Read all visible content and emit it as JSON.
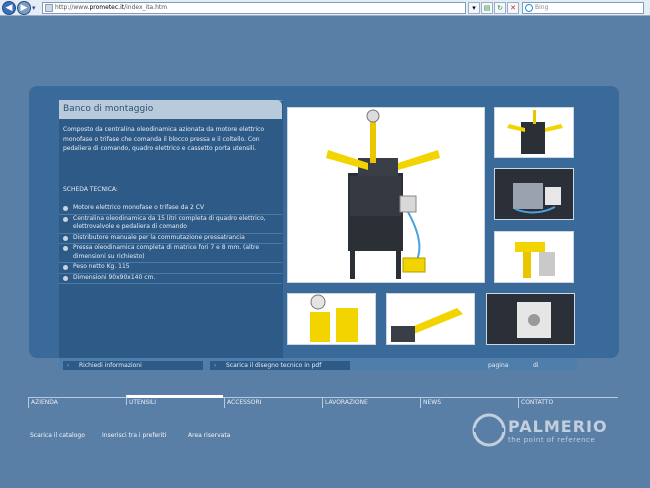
{
  "browser": {
    "url_prefix": "http://www.",
    "url_domain": "prometec.it",
    "url_path": "/index_ita.htm",
    "search_placeholder": "Bing"
  },
  "product": {
    "title": "Banco di montaggio",
    "description": "Composto da centralina oleodinamica azionata da motore elettrico monofase o trifase che comanda il blocco pressa e il coltello. Con pedaliera di comando, quadro elettrico e cassetto porta utensili.",
    "tech_heading": "SCHEDA TECNICA:",
    "specs": [
      "Motore elettrico monofase o trifase da 2 CV",
      "Centralina oleodinamica da 15 litri completa di quadro elettrico, elettrovalvole e pedaliera di comando",
      "Distributore manuale per la commutazione pressatrancia",
      "Pressa oleodinamica completa di matrice fori 7 e 8 mm. (altre dimensioni su richiesto)",
      "Peso netto Kg. 115",
      "Dimensioni 90x90x140 cm."
    ]
  },
  "actions": {
    "info_label": "Richiedi informazioni",
    "pdf_label": "Scarica il disegno tecnico in pdf",
    "page_label": "pagina",
    "of_label": "di"
  },
  "menu": {
    "items": [
      "AZIENDA",
      "UTENSILI",
      "ACCESSORI",
      "LAVORAZIONE",
      "NEWS",
      "CONTATTO"
    ],
    "active": "UTENSILI"
  },
  "footer": {
    "links": [
      "Scarica il catalogo",
      "Inserisci tra i preferiti",
      "Area riservata"
    ]
  },
  "brand": {
    "name": "PALMERIO",
    "tagline": "the point of reference"
  },
  "colors": {
    "background": "#5a7fa6",
    "panel": "#3a6a9a",
    "accent_yellow": "#f2d400"
  }
}
